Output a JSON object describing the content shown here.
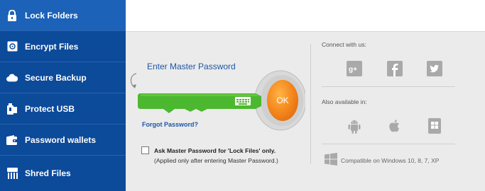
{
  "sidebar": {
    "items": [
      {
        "label": "Lock Folders",
        "icon": "lock-icon"
      },
      {
        "label": "Encrypt Files",
        "icon": "safe-icon"
      },
      {
        "label": "Secure Backup",
        "icon": "cloud-icon"
      },
      {
        "label": "Protect USB",
        "icon": "usb-icon"
      },
      {
        "label": "Password wallets",
        "icon": "wallet-icon"
      },
      {
        "label": "Shred Files",
        "icon": "shredder-icon"
      }
    ],
    "active_index": 0
  },
  "login": {
    "title": "Enter Master Password",
    "ok_label": "OK",
    "forgot_label": "Forgot Password?",
    "keyboard_icon": "keyboard-icon"
  },
  "options": {
    "ask_label": "Ask Master Password for 'Lock Files' only.",
    "ask_note": "(Applied only after entering Master Password.)",
    "ask_checked": false
  },
  "social": {
    "connect_label": "Connect with us:",
    "icons": [
      "google-plus-icon",
      "facebook-icon",
      "twitter-icon"
    ]
  },
  "platforms": {
    "available_label": "Also available in:",
    "icons": [
      "android-icon",
      "apple-icon",
      "windows-phone-icon"
    ]
  },
  "compat": {
    "label": "Compatible on Windows 10, 8, 7, XP",
    "icon": "windows-icon"
  },
  "colors": {
    "sidebar": "#0c4a9a",
    "sidebar_active": "#1c62b8",
    "key_green": "#4cb82f",
    "ok_orange": "#f07a10",
    "link_blue": "#1d56a7"
  }
}
